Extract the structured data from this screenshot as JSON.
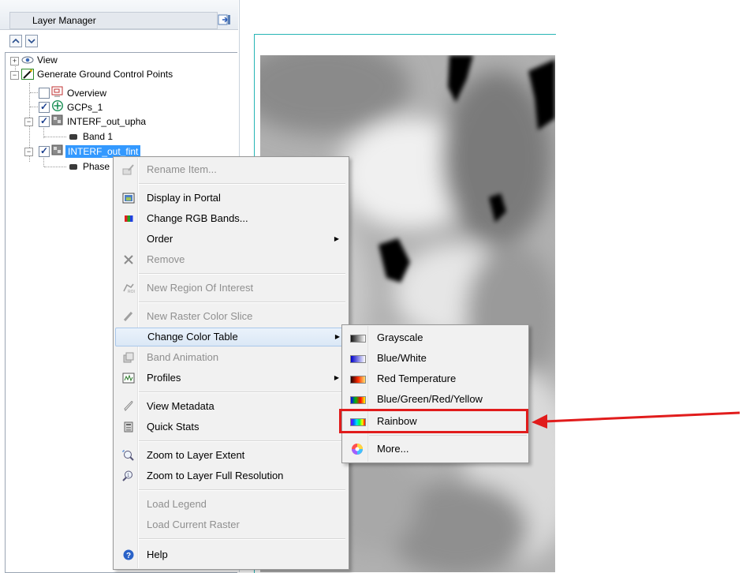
{
  "panel": {
    "title": "Layer Manager"
  },
  "tree": {
    "items": [
      {
        "label": "View"
      },
      {
        "label": "Generate Ground Control Points"
      },
      {
        "label": "Overview"
      },
      {
        "label": "GCPs_1"
      },
      {
        "label": "INTERF_out_upha"
      },
      {
        "label": "Band 1"
      },
      {
        "label": "INTERF_out_fint"
      },
      {
        "label": "Phase"
      }
    ]
  },
  "context_menu": {
    "items": [
      {
        "label": "Rename Item...",
        "enabled": false,
        "icon": "rename-icon"
      },
      {
        "label": "Display in Portal",
        "enabled": true,
        "icon": "portal-icon"
      },
      {
        "label": "Change RGB Bands...",
        "enabled": true,
        "icon": "rgb-icon"
      },
      {
        "label": "Order",
        "enabled": true,
        "submenu": true
      },
      {
        "label": "Remove",
        "enabled": false,
        "icon": "remove-icon"
      },
      {
        "label": "New Region Of Interest",
        "enabled": false,
        "icon": "roi-icon"
      },
      {
        "label": "New Raster Color Slice",
        "enabled": false,
        "icon": "color-slice-icon"
      },
      {
        "label": "Change Color Table",
        "enabled": true,
        "submenu": true
      },
      {
        "label": "Band Animation",
        "enabled": false,
        "icon": "animation-icon"
      },
      {
        "label": "Profiles",
        "enabled": true,
        "submenu": true,
        "icon": "profiles-icon"
      },
      {
        "label": "View Metadata",
        "enabled": true,
        "icon": "metadata-icon"
      },
      {
        "label": "Quick Stats",
        "enabled": true,
        "icon": "stats-icon"
      },
      {
        "label": "Zoom to Layer Extent",
        "enabled": true,
        "icon": "zoom-extent-icon"
      },
      {
        "label": "Zoom to Layer Full Resolution",
        "enabled": true,
        "icon": "zoom-full-icon"
      },
      {
        "label": "Load Legend",
        "enabled": false
      },
      {
        "label": "Load Current Raster",
        "enabled": false
      },
      {
        "label": "Help",
        "enabled": true,
        "icon": "help-icon"
      }
    ]
  },
  "color_table_submenu": {
    "items": [
      {
        "label": "Grayscale",
        "swatch": [
          "#111111",
          "#ffffff"
        ]
      },
      {
        "label": "Blue/White",
        "swatch": [
          "#0000c8",
          "#ffffff"
        ]
      },
      {
        "label": "Red Temperature",
        "swatch": [
          "#200000",
          "#ff2a00",
          "#ffe070"
        ]
      },
      {
        "label": "Blue/Green/Red/Yellow",
        "swatch": [
          "#0000ff",
          "#00c000",
          "#ff0000",
          "#ffff00"
        ]
      },
      {
        "label": "Rainbow",
        "swatch": [
          "#7a00ff",
          "#0060ff",
          "#00e0ff",
          "#00ff40",
          "#ffff00",
          "#ff0000"
        ]
      },
      {
        "label": "More...",
        "icon": "color-wheel-icon"
      }
    ]
  },
  "colors": {
    "annotation": "#e11c1c",
    "frame": "#26b5b5"
  }
}
